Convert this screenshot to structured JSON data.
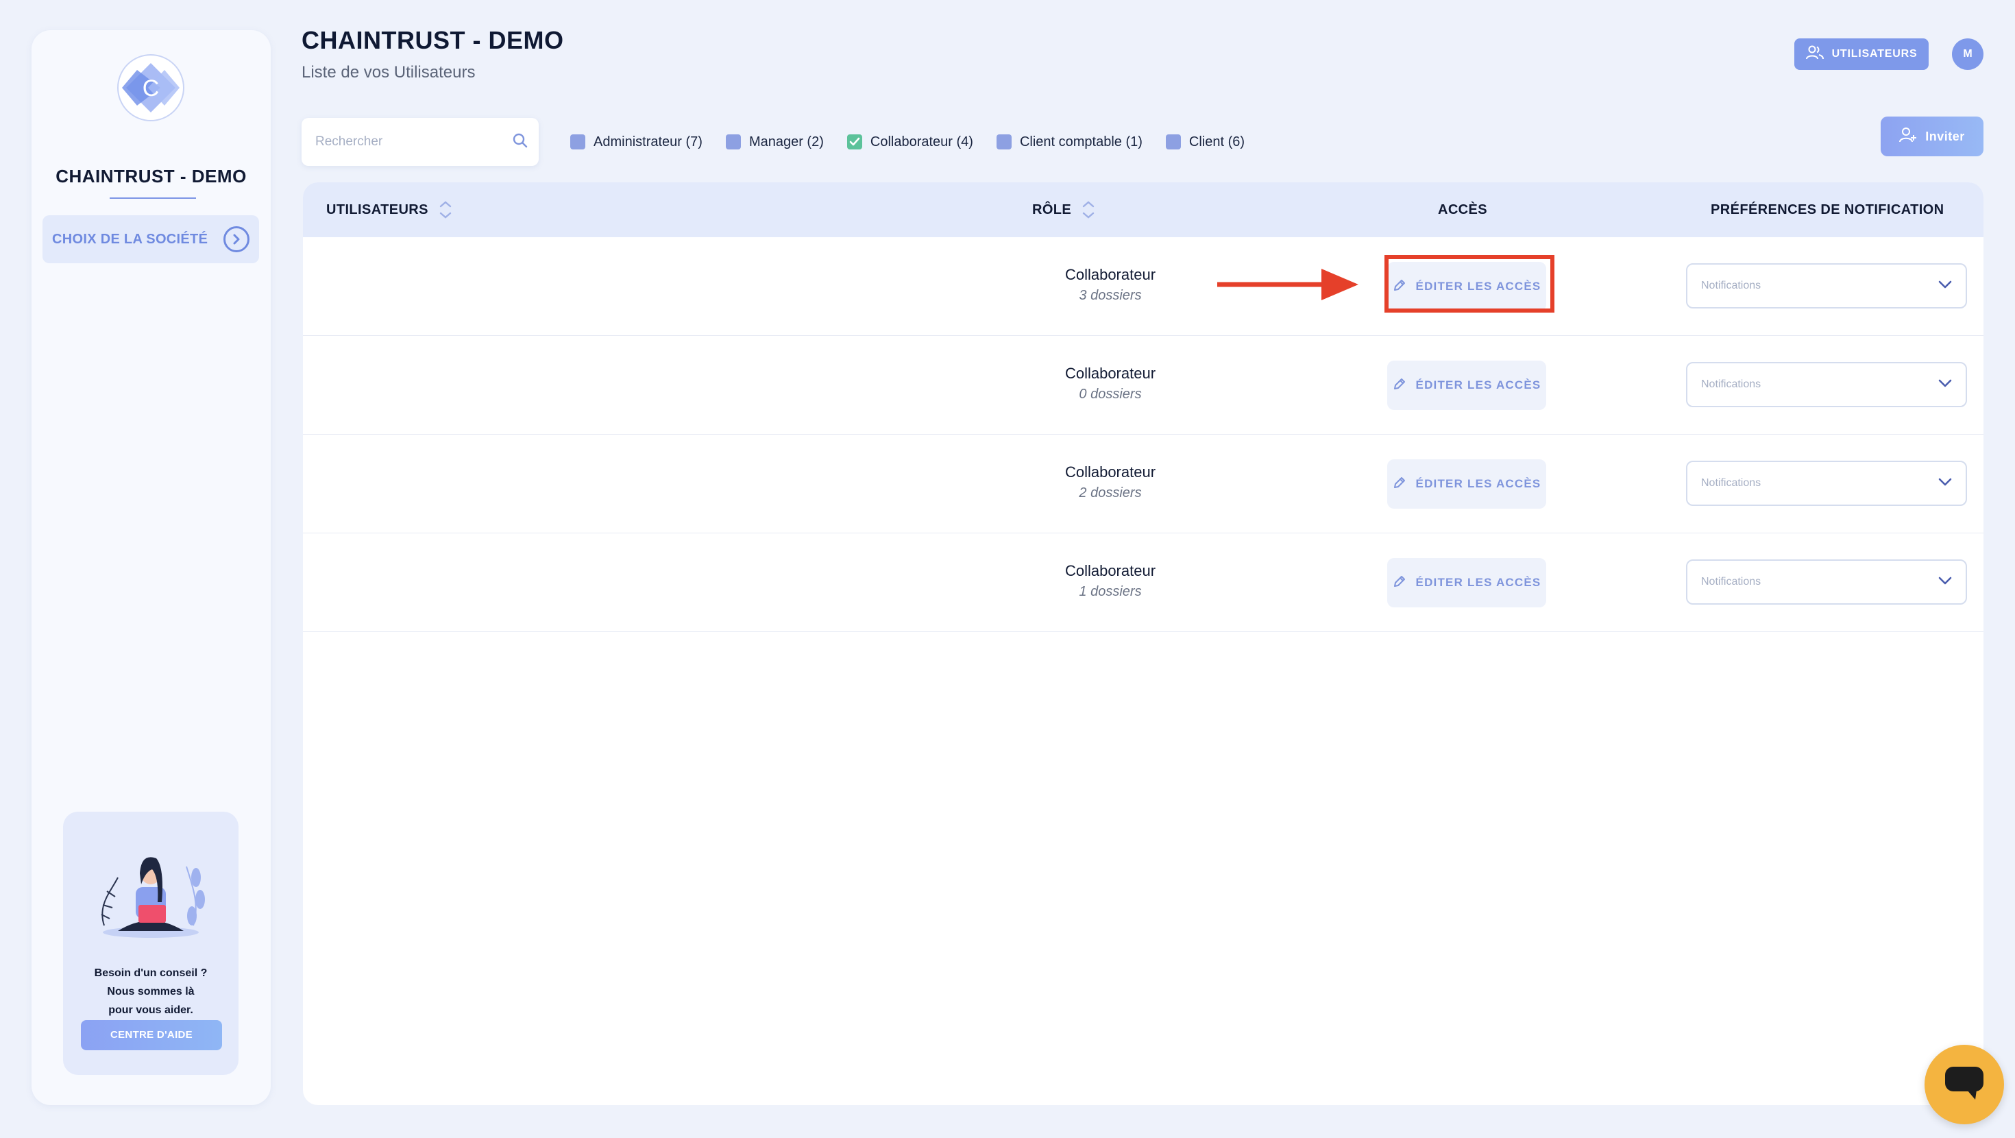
{
  "sidebar": {
    "company_name": "CHAINTRUST - DEMO",
    "company_switch_label": "CHOIX DE LA SOCIÉTÉ",
    "help": {
      "lines": [
        "Besoin d'un conseil ?",
        "Nous sommes là",
        "pour vous aider."
      ],
      "button_label": "CENTRE D'AIDE"
    }
  },
  "header": {
    "title": "CHAINTRUST - DEMO",
    "subtitle": "Liste de vos Utilisateurs",
    "users_button_label": "UTILISATEURS",
    "avatar_initial": "M"
  },
  "search": {
    "placeholder": "Rechercher",
    "value": ""
  },
  "filters": [
    {
      "label": "Administrateur (7)",
      "checked": false
    },
    {
      "label": "Manager (2)",
      "checked": false
    },
    {
      "label": "Collaborateur (4)",
      "checked": true
    },
    {
      "label": "Client comptable (1)",
      "checked": false
    },
    {
      "label": "Client (6)",
      "checked": false
    }
  ],
  "invite_button_label": "Inviter",
  "table": {
    "columns": {
      "users": "UTILISATEURS",
      "role": "RÔLE",
      "access": "ACCÈS",
      "notifications": "PRÉFÉRENCES DE NOTIFICATION"
    },
    "rows": [
      {
        "role": "Collaborateur",
        "folders": "3 dossiers",
        "access_label": "ÉDITER LES ACCÈS",
        "notif_placeholder": "Notifications"
      },
      {
        "role": "Collaborateur",
        "folders": "0 dossiers",
        "access_label": "ÉDITER LES ACCÈS",
        "notif_placeholder": "Notifications"
      },
      {
        "role": "Collaborateur",
        "folders": "2 dossiers",
        "access_label": "ÉDITER LES ACCÈS",
        "notif_placeholder": "Notifications"
      },
      {
        "role": "Collaborateur",
        "folders": "1 dossiers",
        "access_label": "ÉDITER LES ACCÈS",
        "notif_placeholder": "Notifications"
      }
    ]
  },
  "colors": {
    "accent": "#7e99ea",
    "highlight": "#e5402a",
    "checked": "#5cc29a",
    "chat": "#f4b440"
  },
  "icons": {
    "logo": "chaintrust-logo",
    "company_switch": "chevron-right-circle-icon",
    "users_button": "users-icon",
    "search": "search-icon",
    "invite": "user-plus-icon",
    "sort": "sort-arrows-icon",
    "edit": "pencil-icon",
    "dropdown": "chevron-down-icon",
    "chat": "chat-icon"
  }
}
